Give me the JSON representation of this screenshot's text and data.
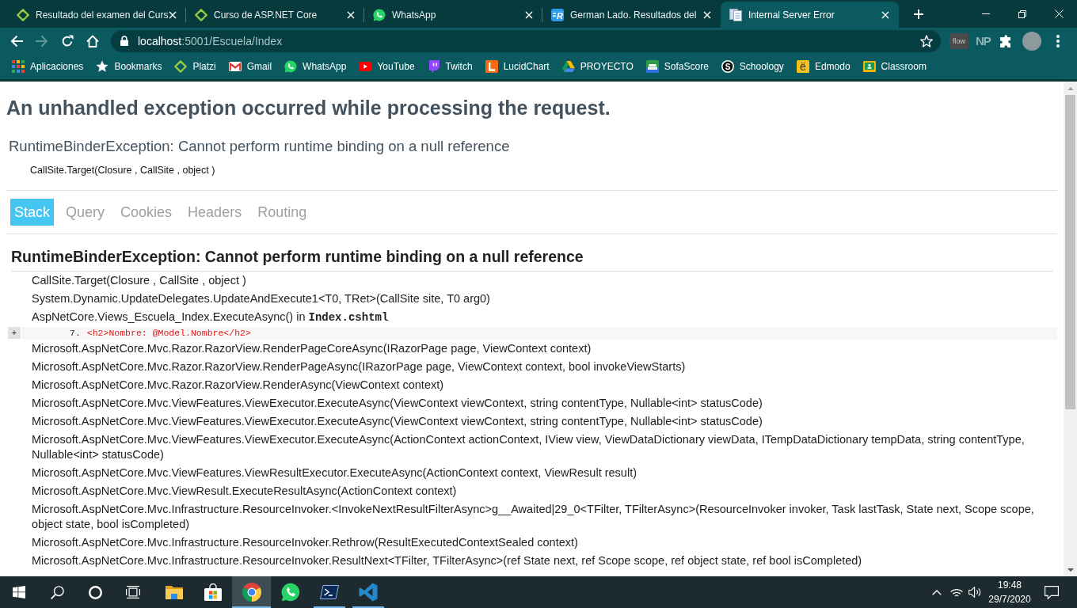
{
  "browser": {
    "tabs": [
      {
        "kind": "diamond",
        "title": "Resultado del examen del Curs",
        "selected": false
      },
      {
        "kind": "diamond",
        "title": "Curso de ASP.NET Core",
        "selected": false
      },
      {
        "kind": "phone-bubble",
        "title": "WhatsApp",
        "selected": false
      },
      {
        "kind": "lined-letter-tile",
        "icon_text": "R",
        "title": "German Lado. Resultados del",
        "selected": false
      },
      {
        "kind": "document",
        "title": "Internal Server Error",
        "selected": true
      }
    ],
    "nav_buttons": [
      {
        "kind": "back",
        "disabled": false
      },
      {
        "kind": "forward",
        "disabled": true
      },
      {
        "kind": "reload",
        "disabled": false
      },
      {
        "kind": "home",
        "disabled": false
      }
    ],
    "address": {
      "host": "localhost",
      "path": ":5001/Escuela/Index"
    },
    "extensions": [
      {
        "kind": "text-tile",
        "text": "flow"
      },
      {
        "kind": "text",
        "text": "NP"
      },
      {
        "kind": "puzzle"
      },
      {
        "kind": "avatar"
      },
      {
        "kind": "menu"
      }
    ],
    "bookmarks": [
      {
        "kind": "apps-grid",
        "label": "Aplicaciones"
      },
      {
        "kind": "star",
        "label": "Bookmarks"
      },
      {
        "kind": "diamond",
        "label": "Platzi"
      },
      {
        "kind": "envelope",
        "label": "Gmail"
      },
      {
        "kind": "phone-bubble",
        "label": "WhatsApp"
      },
      {
        "kind": "play",
        "label": "YouTube"
      },
      {
        "kind": "speech-bubble",
        "label": "Twitch"
      },
      {
        "kind": "corner-tile",
        "label": "LucidChart"
      },
      {
        "kind": "triangle",
        "label": "PROYECTO"
      },
      {
        "kind": "sofa",
        "label": "SofaScore"
      },
      {
        "kind": "letter-circle",
        "icon_text": "S",
        "label": "Schoology"
      },
      {
        "kind": "letter-tile",
        "icon_text": "ë",
        "label": "Edmodo"
      },
      {
        "kind": "board",
        "label": "Classroom"
      }
    ]
  },
  "page": {
    "title": "An unhandled exception occurred while processing the request.",
    "summary": "RuntimeBinderException: Cannot perform runtime binding on a null reference",
    "location": "CallSite.Target(Closure , CallSite , object )",
    "tabs": [
      {
        "label": "Stack",
        "selected": true
      },
      {
        "label": "Query",
        "selected": false
      },
      {
        "label": "Cookies",
        "selected": false
      },
      {
        "label": "Headers",
        "selected": false
      },
      {
        "label": "Routing",
        "selected": false
      }
    ],
    "stack": {
      "heading": "RuntimeBinderException: Cannot perform runtime binding on a null reference",
      "frames": [
        {
          "method": "CallSite.Target(Closure , CallSite , object )"
        },
        {
          "method": "System.Dynamic.UpdateDelegates.UpdateAndExecute1<T0, TRet>(CallSite site, T0 arg0)"
        },
        {
          "method": "AspNetCore.Views_Escuela_Index.ExecuteAsync() in **Index.cshtml**",
          "source": {
            "toggle": "+",
            "line_number": "7.",
            "code": "<h2>Nombre: @Model.Nombre</h2>"
          }
        },
        {
          "method": "Microsoft.AspNetCore.Mvc.Razor.RazorView.RenderPageCoreAsync(IRazorPage page, ViewContext context)"
        },
        {
          "method": "Microsoft.AspNetCore.Mvc.Razor.RazorView.RenderPageAsync(IRazorPage page, ViewContext context, bool invokeViewStarts)"
        },
        {
          "method": "Microsoft.AspNetCore.Mvc.Razor.RazorView.RenderAsync(ViewContext context)"
        },
        {
          "method": "Microsoft.AspNetCore.Mvc.ViewFeatures.ViewExecutor.ExecuteAsync(ViewContext viewContext, string contentType, Nullable<int> statusCode)"
        },
        {
          "method": "Microsoft.AspNetCore.Mvc.ViewFeatures.ViewExecutor.ExecuteAsync(ViewContext viewContext, string contentType, Nullable<int> statusCode)"
        },
        {
          "method": "Microsoft.AspNetCore.Mvc.ViewFeatures.ViewExecutor.ExecuteAsync(ActionContext actionContext, IView view, ViewDataDictionary viewData, ITempDataDictionary tempData, string contentType, Nullable<int> statusCode)"
        },
        {
          "method": "Microsoft.AspNetCore.Mvc.ViewFeatures.ViewResultExecutor.ExecuteAsync(ActionContext context, ViewResult result)"
        },
        {
          "method": "Microsoft.AspNetCore.Mvc.ViewResult.ExecuteResultAsync(ActionContext context)"
        },
        {
          "method": "Microsoft.AspNetCore.Mvc.Infrastructure.ResourceInvoker.<InvokeNextResultFilterAsync>g__Awaited|29_0<TFilter, TFilterAsync>(ResourceInvoker invoker, Task lastTask, State next, Scope scope, object state, bool isCompleted)"
        },
        {
          "method": "Microsoft.AspNetCore.Mvc.Infrastructure.ResourceInvoker.Rethrow(ResultExecutedContextSealed context)"
        },
        {
          "method": "Microsoft.AspNetCore.Mvc.Infrastructure.ResourceInvoker.ResultNext<TFilter, TFilterAsync>(ref State next, ref Scope scope, ref object state, ref bool isCompleted)"
        }
      ]
    }
  },
  "taskbar": {
    "system_buttons": [
      {
        "kind": "start"
      },
      {
        "kind": "search"
      },
      {
        "kind": "ring"
      },
      {
        "kind": "task-view"
      }
    ],
    "apps": [
      {
        "kind": "folder",
        "open": false,
        "selected": false
      },
      {
        "kind": "shopping-bag",
        "open": false,
        "selected": false
      },
      {
        "kind": "tricolor-wheel",
        "open": true,
        "selected": true
      },
      {
        "kind": "phone-bubble",
        "open": false,
        "selected": false
      },
      {
        "kind": "terminal",
        "open": true,
        "selected": false
      },
      {
        "kind": "ribbon",
        "open": true,
        "selected": false
      }
    ],
    "tray": {
      "time": "19:48",
      "date": "29/7/2020"
    }
  }
}
